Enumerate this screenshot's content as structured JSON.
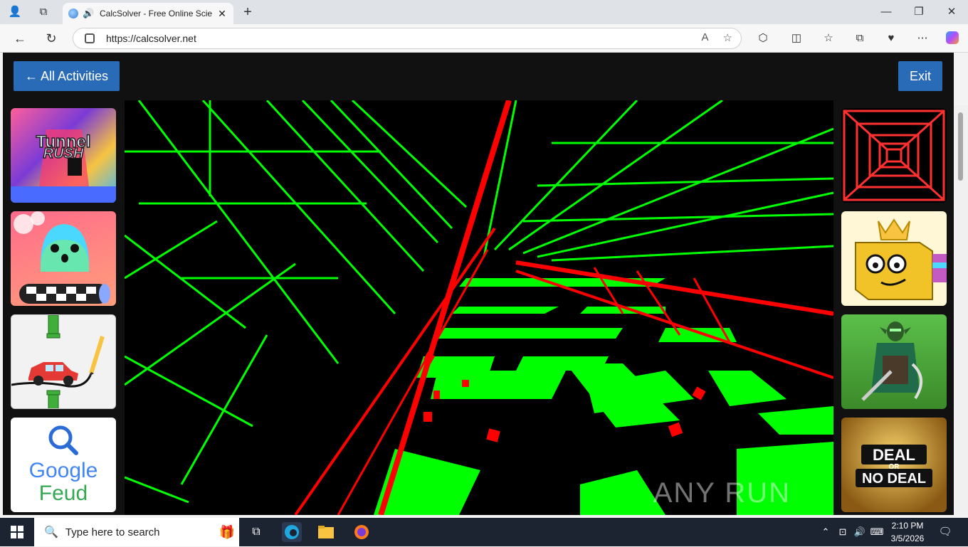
{
  "browser": {
    "tab_title": "CalcSolver - Free Online Scie",
    "url": "https://calcsolver.net"
  },
  "page": {
    "back_label": "← All Activities",
    "exit_label": "Exit",
    "left_games": [
      "Tunnel RUSH",
      "Slime",
      "Draw Car",
      "Google Feud"
    ],
    "right_games": [
      "Red Tunnel",
      "Cube King",
      "Elf Warrior",
      "DEAL OR NO DEAL"
    ],
    "google_feud_line1": "Google",
    "google_feud_line2": "Feud",
    "tunnel_rush_line1": "Tunnel",
    "tunnel_rush_line2": "RUSH",
    "deal_line1": "DEAL",
    "deal_line2": "OR",
    "deal_line3": "NO DEAL",
    "watermark": "ANY RUN"
  },
  "taskbar": {
    "search_placeholder": "Type here to search",
    "time": "2:10 PM",
    "date": "3/5/2026"
  },
  "colors": {
    "accent": "#2a6bb8",
    "game_green": "#00ff00",
    "game_red": "#ff0000"
  }
}
